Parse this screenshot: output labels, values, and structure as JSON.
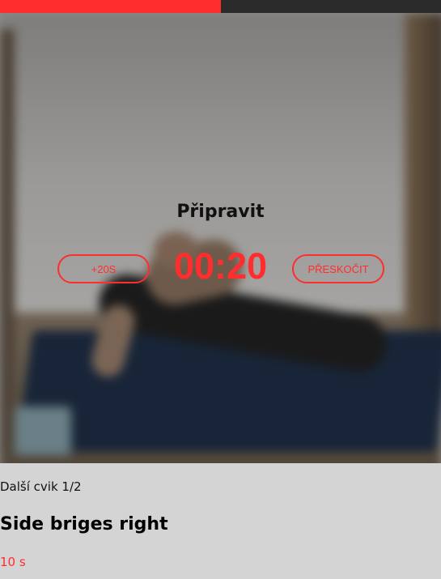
{
  "progress": {
    "fraction": 0.5,
    "fill_color": "#ff2d2d",
    "track_color": "#2a2a2a"
  },
  "overlay": {
    "status_title": "Připravit",
    "timer": "00:20",
    "add_button_label": "+20S",
    "skip_button_label": "PŘESKOČIT",
    "accent_color": "#ff2d2d"
  },
  "next_exercise": {
    "label": "Další cvik 1/2",
    "name": "Side briges right",
    "duration": "10 s"
  }
}
